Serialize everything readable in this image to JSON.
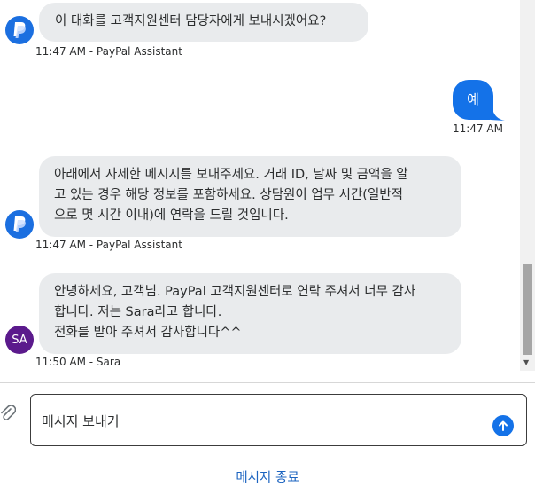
{
  "messages": [
    {
      "sender": "assistant",
      "lines": [
        "이 대화를 고객지원센터 담당자에게 보내시겠어요?"
      ],
      "meta": "11:47 AM - PayPal Assistant"
    },
    {
      "sender": "user",
      "text": "예",
      "meta": "11:47 AM"
    },
    {
      "sender": "assistant",
      "lines": [
        "아래에서 자세한 메시지를 보내주세요. 거래 ID, 날짜 및 금액을 알",
        "고 있는 경우 해당 정보를 포함하세요. 상담원이 업무 시간(일반적",
        "으로 몇 시간 이내)에 연락을 드릴 것입니다."
      ],
      "meta": "11:47 AM - PayPal Assistant"
    },
    {
      "sender": "agent",
      "avatar_initials": "SA",
      "lines": [
        "안녕하세요, 고객님. PayPal 고객지원센터로 연락 주셔서 너무 감사",
        "합니다. 저는 Sara라고 합니다.",
        "전화를 받아 주셔서 감사합니다^^"
      ],
      "meta": "11:50 AM - Sara"
    }
  ],
  "composer": {
    "placeholder": "메시지 보내기"
  },
  "footer": {
    "end_chat_label": "메시지 종료"
  },
  "icons": {
    "assistant_avatar": "paypal-logo-icon",
    "attach": "paperclip-icon",
    "send": "arrow-up-icon"
  },
  "colors": {
    "user_bubble": "#1472e8",
    "incoming_bubble": "#e9ebed",
    "paypal_avatar": "#1b6fe0",
    "agent_avatar": "#5b1a8c",
    "link": "#1c64c0"
  }
}
